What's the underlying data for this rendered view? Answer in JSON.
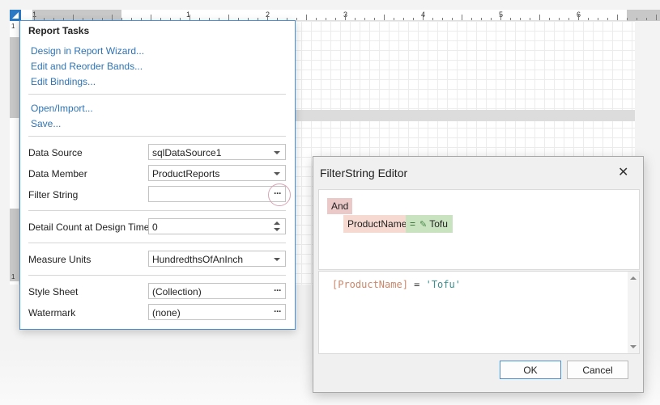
{
  "ruler": {
    "numbers": [
      "1",
      "1",
      "2",
      "3",
      "4",
      "5",
      "6"
    ],
    "vertical_numbers": [
      "1",
      "1"
    ]
  },
  "tasks": {
    "title": "Report Tasks",
    "links": [
      "Design in Report Wizard...",
      "Edit and Reorder Bands...",
      "Edit Bindings...",
      "Open/Import...",
      "Save..."
    ],
    "properties": {
      "data_source": {
        "label": "Data Source",
        "value": "sqlDataSource1"
      },
      "data_member": {
        "label": "Data Member",
        "value": "ProductReports"
      },
      "filter_string": {
        "label": "Filter String",
        "value": ""
      },
      "detail_count": {
        "label": "Detail Count at Design Time",
        "value": "0"
      },
      "measure_units": {
        "label": "Measure Units",
        "value": "HundredthsOfAnInch"
      },
      "style_sheet": {
        "label": "Style Sheet",
        "value": "(Collection)"
      },
      "watermark": {
        "label": "Watermark",
        "value": "(none)"
      }
    },
    "ellipsis": "···"
  },
  "dialog": {
    "title": "FilterString Editor",
    "close": "✕",
    "tree": {
      "group_op": "And",
      "field": "ProductName",
      "operator": "=",
      "value": "Tofu"
    },
    "expression": {
      "field": "[ProductName]",
      "operator": " = ",
      "value": "'Tofu'"
    },
    "ok_label": "OK",
    "cancel_label": "Cancel"
  },
  "colors": {
    "accent": "#4a8fd3",
    "link": "#2e74b5",
    "group_token": "#ecc9c9",
    "field_token": "#f6dad2",
    "value_token": "#c9e3c1"
  }
}
